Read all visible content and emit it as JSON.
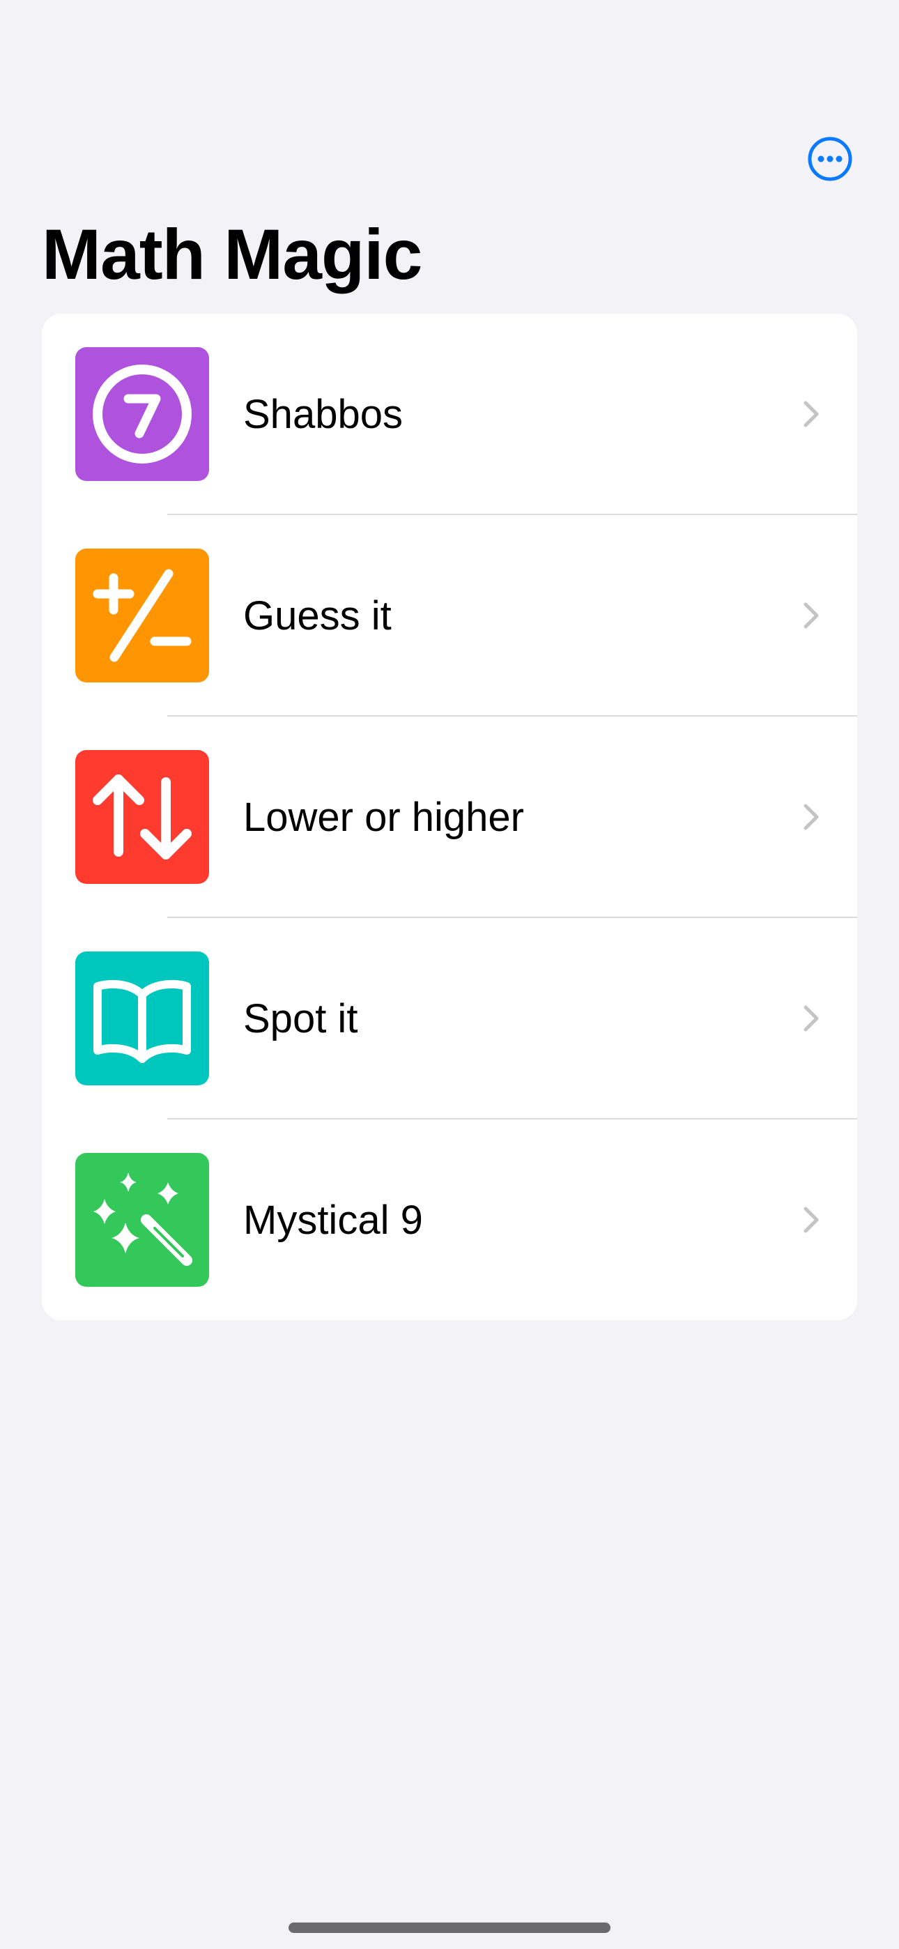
{
  "header": {
    "title": "Math Magic",
    "more_icon": "ellipsis-circle-icon",
    "accent_color": "#0a7aff"
  },
  "list": {
    "items": [
      {
        "label": "Shabbos",
        "icon": "number-seven-circle-icon",
        "icon_color": "#af52de"
      },
      {
        "label": "Guess it",
        "icon": "plus-slash-minus-icon",
        "icon_color": "#ff9500"
      },
      {
        "label": "Lower or higher",
        "icon": "arrow-up-arrow-down-icon",
        "icon_color": "#ff3b30"
      },
      {
        "label": "Spot it",
        "icon": "book-icon",
        "icon_color": "#00c7be"
      },
      {
        "label": "Mystical 9",
        "icon": "wand-and-stars-icon",
        "icon_color": "#34c759"
      }
    ],
    "chevron_icon": "chevron-right-icon"
  },
  "colors": {
    "background": "#f2f2f7",
    "card": "#ffffff",
    "separator": "#dcdce0",
    "chevron": "#c4c4c7"
  }
}
